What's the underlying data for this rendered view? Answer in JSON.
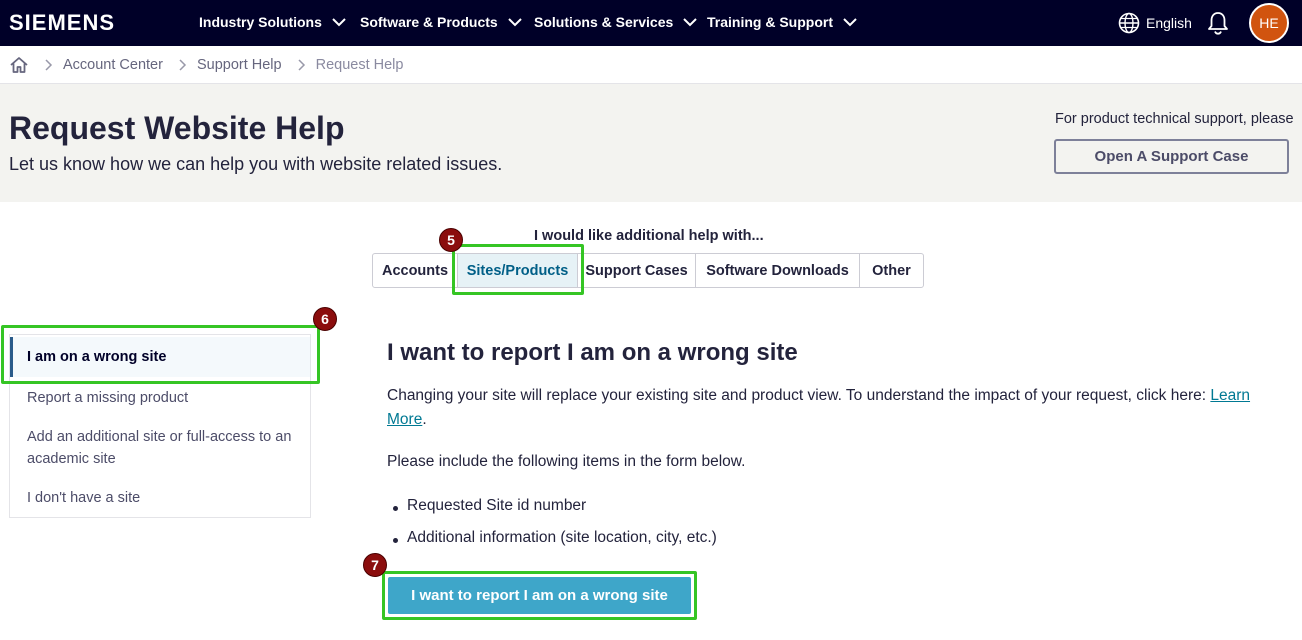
{
  "topnav": {
    "logo": "SIEMENS",
    "items": [
      {
        "label": "Industry Solutions"
      },
      {
        "label": "Software & Products"
      },
      {
        "label": "Solutions & Services"
      },
      {
        "label": "Training & Support"
      }
    ],
    "language": "English",
    "avatar_initials": "HE",
    "colors": {
      "bar": "#000028",
      "avatar": "#d1540f"
    }
  },
  "breadcrumb": {
    "items": [
      "Account Center",
      "Support Help",
      "Request Help"
    ]
  },
  "hero": {
    "title": "Request Website Help",
    "subtitle": "Let us know how we can help you with website related issues.",
    "support_text": "For product technical support, please",
    "support_button": "Open A Support Case"
  },
  "tabs": {
    "heading": "I would like additional help with...",
    "items": [
      "Accounts",
      "Sites/Products",
      "Support Cases",
      "Software Downloads",
      "Other"
    ],
    "selected": "Sites/Products"
  },
  "steps": [
    "5",
    "6",
    "7"
  ],
  "sidemenu": {
    "items": [
      {
        "label": "I am on a wrong site",
        "active": true
      },
      {
        "label": "Report a missing product"
      },
      {
        "label": "Add an additional site or full-access to an academic site"
      },
      {
        "label": "I don't have a site"
      }
    ]
  },
  "main": {
    "title": "I want to report I am on a wrong site",
    "paragraph": "Changing your site will replace your existing site and product view. To understand the impact of your request, click here: ",
    "link": "Learn More",
    "paragraph_end": ".",
    "instructions": "Please include the following items in the form below.",
    "bullets": [
      "Requested Site id number",
      "Additional information (site location, city, etc.)"
    ],
    "button": "I want to report I am on a wrong site"
  },
  "colors": {
    "highlight": "#35c524",
    "step_marker": "#8b0d0d",
    "primary_button": "#3ea6c9",
    "link": "#007993"
  }
}
